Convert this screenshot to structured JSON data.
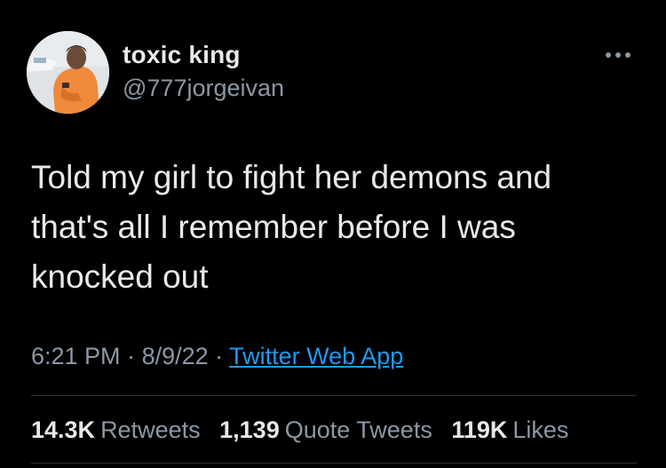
{
  "author": {
    "display_name": "toxic king",
    "handle": "@777jorgeivan"
  },
  "more_icon": "ellipsis-icon",
  "tweet": {
    "text": "Told my girl to fight her demons and\nthat's all I remember before I was\nknocked out"
  },
  "meta": {
    "time": "6:21 PM",
    "sep1": " · ",
    "date": "8/9/22",
    "sep2": " · ",
    "source": "Twitter Web App"
  },
  "stats": {
    "retweets": {
      "count": "14.3K",
      "label": "Retweets"
    },
    "quotes": {
      "count": "1,139",
      "label": "Quote Tweets"
    },
    "likes": {
      "count": "119K",
      "label": "Likes"
    }
  },
  "colors": {
    "background": "#000000",
    "primary_text": "#e7e9ea",
    "secondary_text": "#8b98a5",
    "link": "#1d9bf0",
    "divider": "#2f3336"
  }
}
